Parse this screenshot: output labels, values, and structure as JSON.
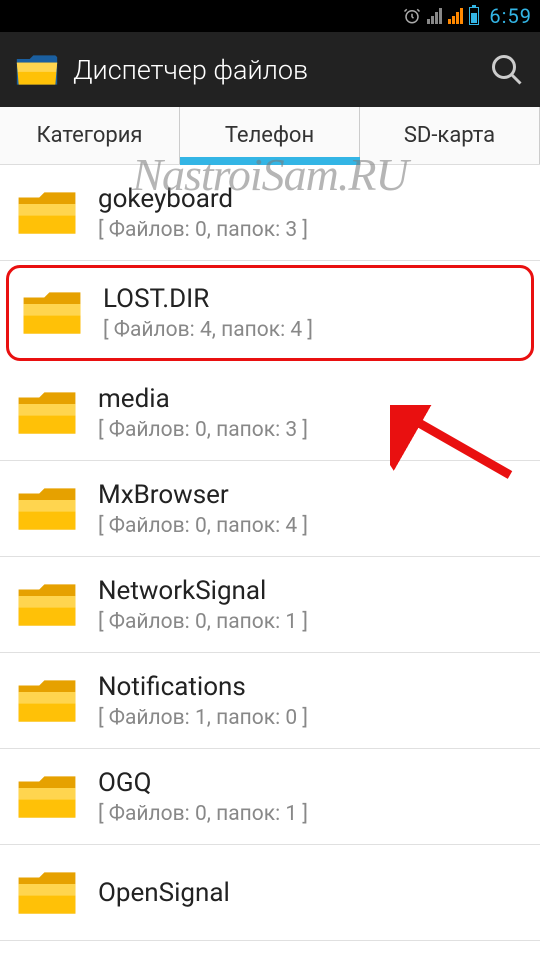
{
  "status": {
    "time": "6:59"
  },
  "header": {
    "title": "Диспетчер файлов"
  },
  "tabs": {
    "items": [
      {
        "label": "Категория"
      },
      {
        "label": "Телефон"
      },
      {
        "label": "SD-карта"
      }
    ],
    "active_index": 1
  },
  "watermark": "NastroiSam.RU",
  "folders": [
    {
      "name": "gokeyboard",
      "meta": "[ Файлов: 0, папок: 3 ]",
      "highlight": false
    },
    {
      "name": "LOST.DIR",
      "meta": "[ Файлов: 4, папок: 4 ]",
      "highlight": true
    },
    {
      "name": "media",
      "meta": "[ Файлов: 0, папок: 3 ]",
      "highlight": false
    },
    {
      "name": "MxBrowser",
      "meta": "[ Файлов: 0, папок: 4 ]",
      "highlight": false
    },
    {
      "name": "NetworkSignal",
      "meta": "[ Файлов: 0, папок: 1 ]",
      "highlight": false
    },
    {
      "name": "Notifications",
      "meta": "[ Файлов: 1, папок: 0 ]",
      "highlight": false
    },
    {
      "name": "OGQ",
      "meta": "[ Файлов: 0, папок: 1 ]",
      "highlight": false
    },
    {
      "name": "OpenSignal",
      "meta": "",
      "highlight": false
    }
  ]
}
